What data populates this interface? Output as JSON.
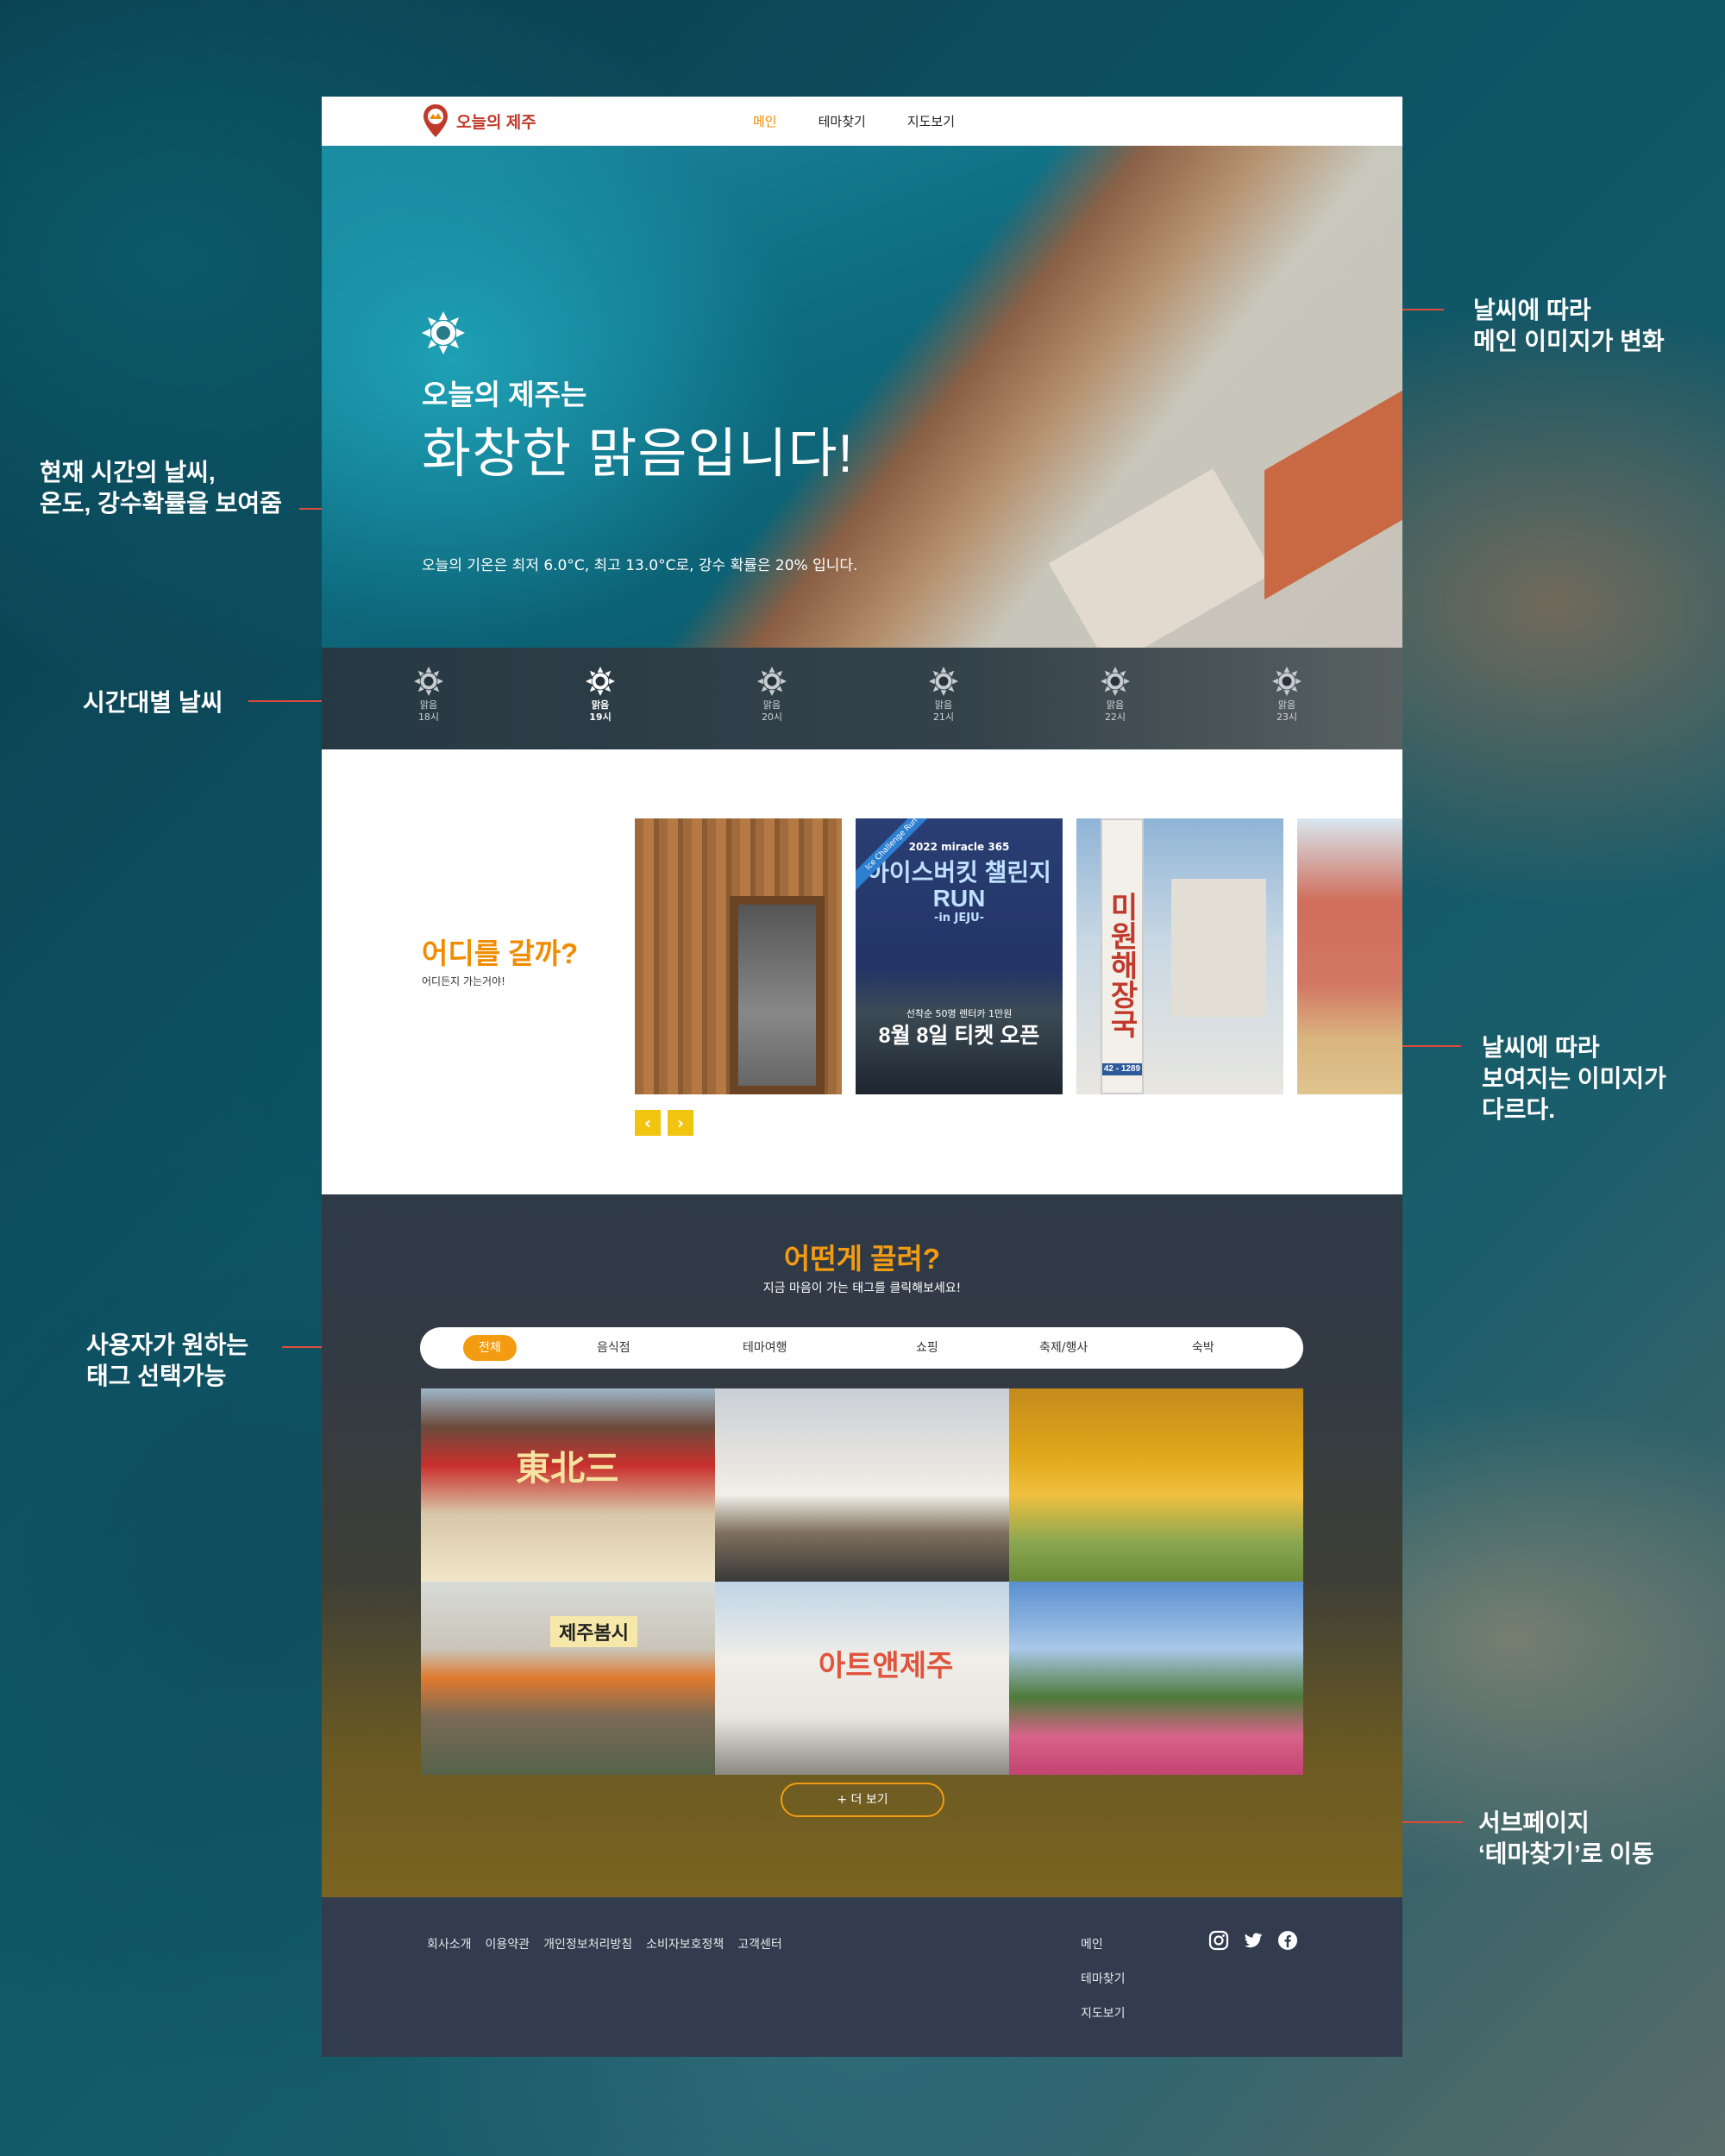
{
  "header": {
    "logo_text": "오늘의 제주",
    "nav": [
      "메인",
      "테마찾기",
      "지도보기"
    ]
  },
  "hero": {
    "subtitle": "오늘의 제주는",
    "title": "화창한 맑음입니다!",
    "description": "오늘의 기온은 최저 6.0°C, 최고 13.0°C로, 강수 확률은 20% 입니다."
  },
  "hourly": [
    {
      "weather": "맑음",
      "time": "18시"
    },
    {
      "weather": "맑음",
      "time": "19시"
    },
    {
      "weather": "맑음",
      "time": "20시"
    },
    {
      "weather": "맑음",
      "time": "21시"
    },
    {
      "weather": "맑음",
      "time": "22시"
    },
    {
      "weather": "맑음",
      "time": "23시"
    }
  ],
  "where": {
    "title": "어디를 갈까?",
    "subtitle": "어디든지 가는거야!",
    "card2": {
      "ribbon": "Ice Challenge Run",
      "year": "2022 miracle 365",
      "title": "아이스버킷 챌린지RUN",
      "in": "-in JEJU-",
      "small": "선착순 50명 렌터카 1만원",
      "big": "8월 8일 티켓 오픈"
    },
    "card3": {
      "sign": "미원해장국",
      "phone": "42 - 1289"
    }
  },
  "tags": {
    "title": "어떤게 끌려?",
    "subtitle": "지금 마음이 가는 태그를 클릭해보세요!",
    "items": [
      "전체",
      "음식점",
      "테마여행",
      "쇼핑",
      "축제/행사",
      "숙박"
    ],
    "grid_labels": [
      "東北三",
      "제주봄시",
      "아트앤제주"
    ],
    "more": "+ 더 보기"
  },
  "footer": {
    "links": [
      "회사소개",
      "이용약관",
      "개인정보처리방침",
      "소비자보호정책",
      "고객센터"
    ],
    "nav": [
      "메인",
      "테마찾기",
      "지도보기"
    ],
    "social": [
      "instagram-icon",
      "twitter-icon",
      "facebook-icon"
    ]
  },
  "annotations": {
    "main_image": [
      "날씨에 따라",
      "메인 이미지가 변화"
    ],
    "current_weather": [
      "현재 시간의 날씨,",
      "온도, 강수확률을 보여줌"
    ],
    "hourly_weather": [
      "시간대별 날씨"
    ],
    "weather_images": [
      "날씨에 따라",
      "보여지는 이미지가",
      "다르다."
    ],
    "tag_select": [
      "사용자가 원하는",
      "태그 선택가능"
    ],
    "subpage": [
      "서브페이지",
      "‘테마찾기’로 이동"
    ]
  },
  "colors": {
    "accent": "#f08c00",
    "brand": "#c0392b",
    "footer_bg": "#323c4e",
    "annotation_line": "#e04a3b"
  }
}
